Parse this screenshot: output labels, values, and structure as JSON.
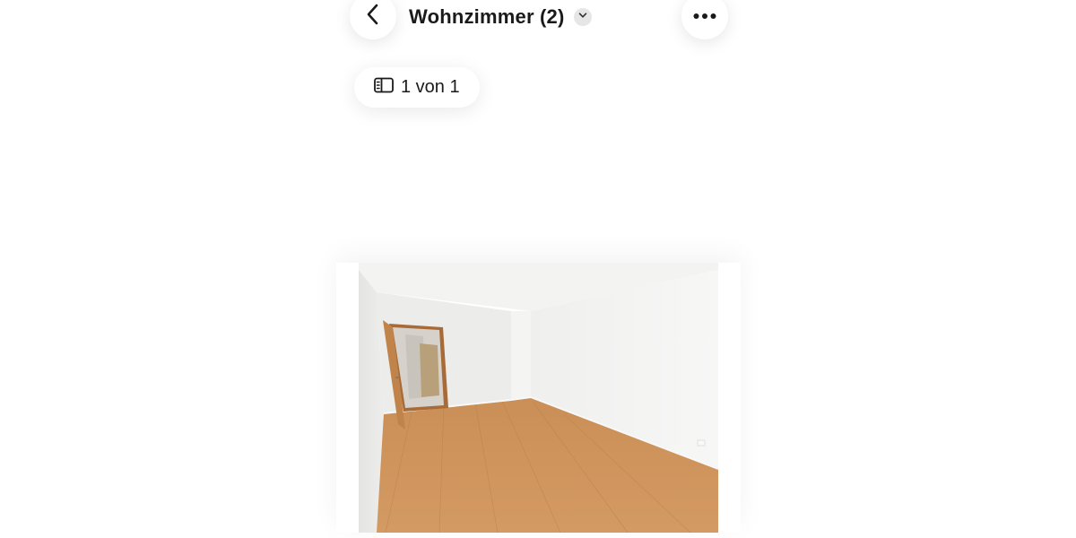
{
  "header": {
    "title": "Wohnzimmer (2)",
    "back_icon": "chevron-left-icon",
    "dropdown_icon": "chevron-down-icon",
    "more_icon": "more-horizontal-icon"
  },
  "gallery": {
    "counter_icon": "sidebar-panel-icon",
    "counter_text": "1 von 1",
    "photo_description_icon": "room-photo"
  },
  "colors": {
    "text": "#1a1a1a",
    "pill_bg": "#ffffff",
    "chevron_bg": "#e6e6e6"
  }
}
